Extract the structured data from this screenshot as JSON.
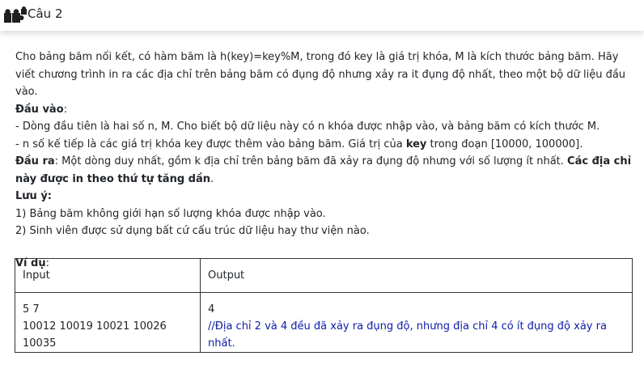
{
  "header": {
    "icon": "puzzle-piece-icon",
    "title": "Câu 2"
  },
  "problem": {
    "intro": "Cho bảng băm nối kết, có hàm băm là h(key)=key%M, trong đó key là giá trị khóa, M là kích thước bảng băm. Hãy viết chương trình in ra các địa chỉ trên bảng băm có đụng độ nhưng xảy ra it đụng độ nhất, theo một bộ dữ liệu đầu vào.",
    "input_heading": "Đầu vào",
    "input_heading_colon": ":",
    "input_line1": "- Dòng đầu tiên là hai số n, M. Cho biết bộ dữ liệu này có n khóa được nhập vào, và bảng băm có kích thước M.",
    "input_line2_a": "- n số kế tiếp là các giá trị khóa key được thêm vào bảng băm. Giá trị của ",
    "input_line2_key": "key",
    "input_line2_b": " trong đoạn [10000, 100000].",
    "output_heading": "Đầu ra",
    "output_text": ": Một dòng duy nhất, gồm k địa chỉ trên bảng băm đã xảy ra đụng độ nhưng với số lượng ít nhất. ",
    "output_bold": "Các địa chỉ này được in theo thứ tự tăng dần",
    "output_end": ".",
    "note_heading": "Lưu ý:",
    "note1": "1) Bảng băm không giới hạn số lượng khóa được nhập vào.",
    "note2": "2) Sinh viên được sử dụng bất cứ cấu trúc dữ liệu hay thư viện nào.",
    "example_heading": "Ví dụ",
    "example_colon": ":"
  },
  "example_table": {
    "col_input": "Input",
    "col_output": "Output",
    "input_line1": "5 7",
    "input_line2": "10012 10019 10021 10026 10035",
    "output_line1": "4",
    "output_comment": "//Địa chỉ 2 và 4 đều đã xảy ra đụng độ, nhưng địa chỉ 4 có ít đụng độ xảy ra nhất.",
    "comment_color": "#0d1ba8"
  }
}
